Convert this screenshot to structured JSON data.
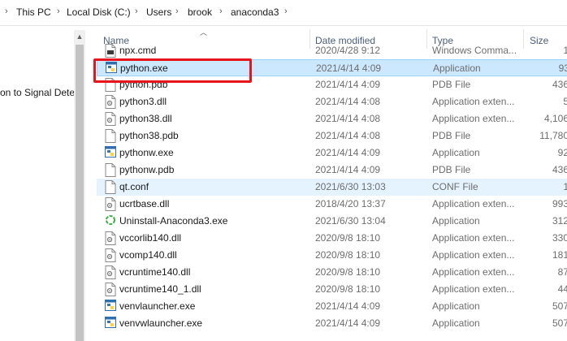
{
  "breadcrumb": [
    "This PC",
    "Local Disk (C:)",
    "Users",
    "brook",
    "anaconda3"
  ],
  "nav": {
    "item_label": "on to Signal Dete"
  },
  "columns": {
    "name": "Name",
    "date": "Date modified",
    "type": "Type",
    "size": "Size"
  },
  "files": [
    {
      "name": "npx.cmd",
      "date": "2020/4/28 9:12",
      "type": "Windows Comma...",
      "size": "1",
      "icon": "cmd-file-icon"
    },
    {
      "name": "python.exe",
      "date": "2021/4/14 4:09",
      "type": "Application",
      "size": "93",
      "icon": "python-exe-icon",
      "selected": true
    },
    {
      "name": "python.pdb",
      "date": "2021/4/14 4:09",
      "type": "PDB File",
      "size": "436",
      "icon": "file-icon"
    },
    {
      "name": "python3.dll",
      "date": "2021/4/14 4:08",
      "type": "Application exten...",
      "size": "5",
      "icon": "dll-icon"
    },
    {
      "name": "python38.dll",
      "date": "2021/4/14 4:08",
      "type": "Application exten...",
      "size": "4,106",
      "icon": "dll-icon"
    },
    {
      "name": "python38.pdb",
      "date": "2021/4/14 4:08",
      "type": "PDB File",
      "size": "11,780",
      "icon": "file-icon"
    },
    {
      "name": "pythonw.exe",
      "date": "2021/4/14 4:09",
      "type": "Application",
      "size": "92",
      "icon": "python-exe-icon"
    },
    {
      "name": "pythonw.pdb",
      "date": "2021/4/14 4:09",
      "type": "PDB File",
      "size": "436",
      "icon": "file-icon"
    },
    {
      "name": "qt.conf",
      "date": "2021/6/30 13:03",
      "type": "CONF File",
      "size": "1",
      "icon": "file-icon",
      "hover": true
    },
    {
      "name": "ucrtbase.dll",
      "date": "2018/4/20 13:37",
      "type": "Application exten...",
      "size": "993",
      "icon": "dll-icon"
    },
    {
      "name": "Uninstall-Anaconda3.exe",
      "date": "2021/6/30 13:04",
      "type": "Application",
      "size": "312",
      "icon": "uninstall-icon"
    },
    {
      "name": "vccorlib140.dll",
      "date": "2020/9/8 18:10",
      "type": "Application exten...",
      "size": "330",
      "icon": "dll-icon"
    },
    {
      "name": "vcomp140.dll",
      "date": "2020/9/8 18:10",
      "type": "Application exten...",
      "size": "181",
      "icon": "dll-icon"
    },
    {
      "name": "vcruntime140.dll",
      "date": "2020/9/8 18:10",
      "type": "Application exten...",
      "size": "87",
      "icon": "dll-icon"
    },
    {
      "name": "vcruntime140_1.dll",
      "date": "2020/9/8 18:10",
      "type": "Application exten...",
      "size": "44",
      "icon": "dll-icon"
    },
    {
      "name": "venvlauncher.exe",
      "date": "2021/4/14 4:09",
      "type": "Application",
      "size": "507",
      "icon": "python-exe-icon"
    },
    {
      "name": "venvwlauncher.exe",
      "date": "2021/4/14 4:09",
      "type": "Application",
      "size": "507",
      "icon": "python-exe-icon"
    }
  ],
  "colors": {
    "selected_bg": "#cce8ff",
    "hover_bg": "#e5f3ff",
    "highlight_box": "#e8141b"
  }
}
